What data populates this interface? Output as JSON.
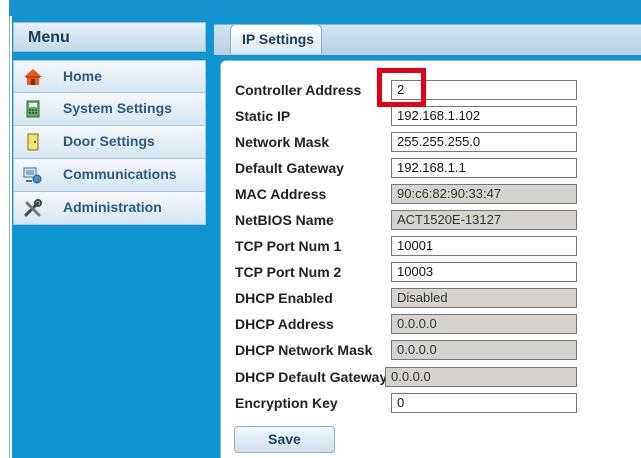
{
  "menu": {
    "title": "Menu",
    "items": [
      {
        "label": "Home",
        "icon": "home-icon"
      },
      {
        "label": "System Settings",
        "icon": "system-settings-icon"
      },
      {
        "label": "Door Settings",
        "icon": "door-icon"
      },
      {
        "label": "Communications",
        "icon": "communications-icon"
      },
      {
        "label": "Administration",
        "icon": "tools-icon"
      }
    ]
  },
  "tab": {
    "label": "IP Settings"
  },
  "form": {
    "fields": [
      {
        "label": "Controller Address",
        "value": "2",
        "readonly": false
      },
      {
        "label": "Static IP",
        "value": "192.168.1.102",
        "readonly": false
      },
      {
        "label": "Network Mask",
        "value": "255.255.255.0",
        "readonly": false
      },
      {
        "label": "Default Gateway",
        "value": "192.168.1.1",
        "readonly": false
      },
      {
        "label": "MAC Address",
        "value": "90:c6:82:90:33:47",
        "readonly": true
      },
      {
        "label": "NetBIOS Name",
        "value": "ACT1520E-13127",
        "readonly": true
      },
      {
        "label": "TCP Port Num 1",
        "value": "10001",
        "readonly": false
      },
      {
        "label": "TCP Port Num 2",
        "value": "10003",
        "readonly": false
      },
      {
        "label": "DHCP Enabled",
        "value": "Disabled",
        "readonly": true
      },
      {
        "label": "DHCP Address",
        "value": "0.0.0.0",
        "readonly": true
      },
      {
        "label": "DHCP Network Mask",
        "value": "0.0.0.0",
        "readonly": true
      },
      {
        "label": "DHCP Default Gateway",
        "value": "0.0.0.0",
        "readonly": true
      },
      {
        "label": "Encryption Key",
        "value": "0",
        "readonly": false
      }
    ],
    "save_label": "Save"
  },
  "colors": {
    "sidebar_bg": "#0f96d2",
    "highlight": "#e3001b",
    "readonly_bg": "#d6d3ce"
  }
}
